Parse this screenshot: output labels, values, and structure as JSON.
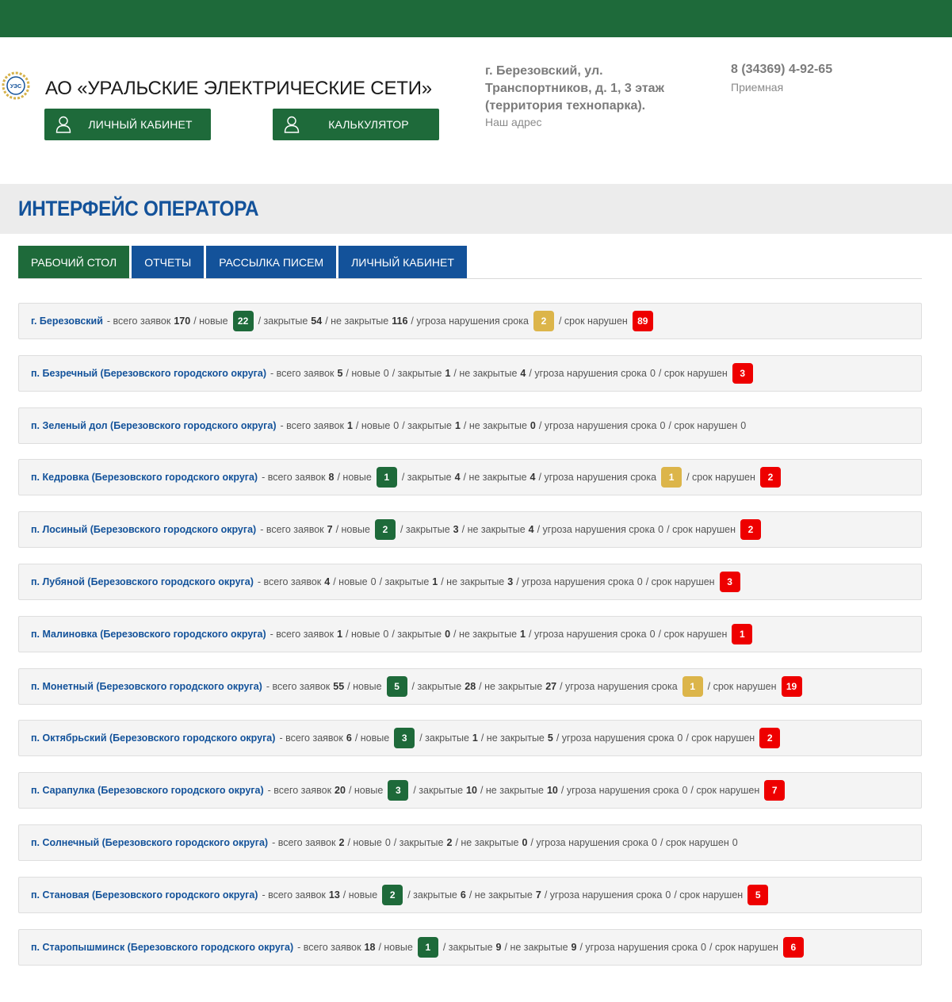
{
  "header": {
    "company": "АО «УРАЛЬСКИЕ ЭЛЕКТРИЧЕСКИЕ СЕТИ»",
    "logo_text": "УЭС",
    "buttons": {
      "cabinet": "ЛИЧНЫЙ КАБИНЕТ",
      "calculator": "КАЛЬКУЛЯТОР"
    },
    "address": "г. Березовский, ул. Транспортников, д. 1, 3 этаж (территория технопарка).",
    "address_label": "Наш адрес",
    "phone": "8 (34369) 4-92-65",
    "phone_label": "Приемная",
    "brand_green": "#1e6a3a",
    "brand_blue": "#13529a"
  },
  "page_title": "ИНТЕРФЕЙС ОПЕРАТОРА",
  "tabs": [
    {
      "label": "РАБОЧИЙ СТОЛ",
      "active": true
    },
    {
      "label": "ОТЧЕТЫ",
      "active": false
    },
    {
      "label": "РАССЫЛКА ПИСЕМ",
      "active": false
    },
    {
      "label": "ЛИЧНЫЙ КАБИНЕТ",
      "active": false
    }
  ],
  "labels": {
    "total": "- всего заявок",
    "new": "/ новые",
    "closed": "/ закрытые",
    "not_closed": "/ не закрытые",
    "threat": "/ угроза нарушения срока",
    "violated": "/ срок нарушен"
  },
  "rows": [
    {
      "place": "г. Березовский",
      "total": "170",
      "new": "22",
      "closed": "54",
      "not_closed": "116",
      "threat": "2",
      "violated": "89"
    },
    {
      "place": "п. Безречный (Березовского городского округа)",
      "total": "5",
      "new": "0",
      "closed": "1",
      "not_closed": "4",
      "threat": "0",
      "violated": "3"
    },
    {
      "place": "п. Зеленый дол (Березовского городского округа)",
      "total": "1",
      "new": "0",
      "closed": "1",
      "not_closed": "0",
      "threat": "0",
      "violated": "0"
    },
    {
      "place": "п. Кедровка (Березовского городского округа)",
      "total": "8",
      "new": "1",
      "closed": "4",
      "not_closed": "4",
      "threat": "1",
      "violated": "2"
    },
    {
      "place": "п. Лосиный (Березовского городского округа)",
      "total": "7",
      "new": "2",
      "closed": "3",
      "not_closed": "4",
      "threat": "0",
      "violated": "2"
    },
    {
      "place": "п. Лубяной (Березовского городского округа)",
      "total": "4",
      "new": "0",
      "closed": "1",
      "not_closed": "3",
      "threat": "0",
      "violated": "3"
    },
    {
      "place": "п. Малиновка (Березовского городского округа)",
      "total": "1",
      "new": "0",
      "closed": "0",
      "not_closed": "1",
      "threat": "0",
      "violated": "1"
    },
    {
      "place": "п. Монетный (Березовского городского округа)",
      "total": "55",
      "new": "5",
      "closed": "28",
      "not_closed": "27",
      "threat": "1",
      "violated": "19"
    },
    {
      "place": "п. Октябрьский (Березовского городского округа)",
      "total": "6",
      "new": "3",
      "closed": "1",
      "not_closed": "5",
      "threat": "0",
      "violated": "2"
    },
    {
      "place": "п. Сарапулка (Березовского городского округа)",
      "total": "20",
      "new": "3",
      "closed": "10",
      "not_closed": "10",
      "threat": "0",
      "violated": "7"
    },
    {
      "place": "п. Солнечный (Березовского городского округа)",
      "total": "2",
      "new": "0",
      "closed": "2",
      "not_closed": "0",
      "threat": "0",
      "violated": "0"
    },
    {
      "place": "п. Становая (Березовского городского округа)",
      "total": "13",
      "new": "2",
      "closed": "6",
      "not_closed": "7",
      "threat": "0",
      "violated": "5"
    },
    {
      "place": "п. Старопышминск (Березовского городского округа)",
      "total": "18",
      "new": "1",
      "closed": "9",
      "not_closed": "9",
      "threat": "0",
      "violated": "6"
    }
  ]
}
